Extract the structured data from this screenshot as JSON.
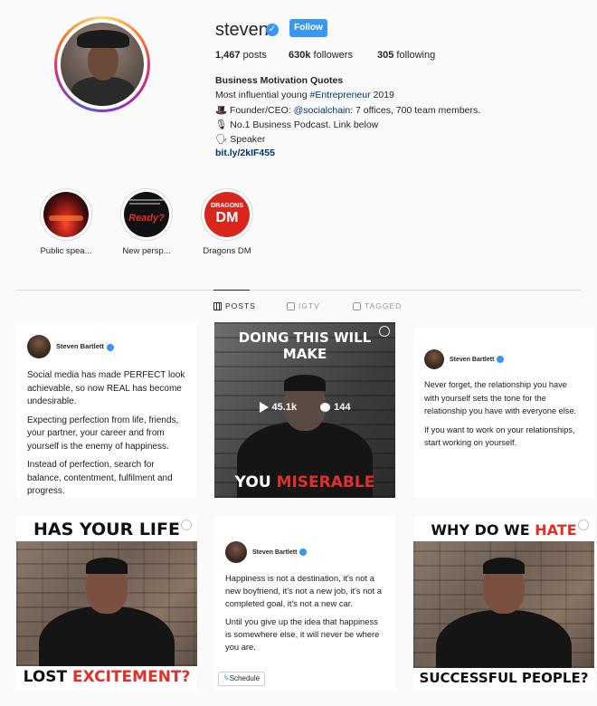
{
  "profile": {
    "username": "steven",
    "follow_label": "Follow",
    "stats": {
      "posts_count": "1,467",
      "posts_label": "posts",
      "followers_count": "630k",
      "followers_label": "followers",
      "following_count": "305",
      "following_label": "following"
    },
    "bio": {
      "name": "Business Motivation Quotes",
      "line1_prefix": "Most influential young ",
      "line1_tag": "#Entrepreneur",
      "line1_suffix": " 2019",
      "line2_prefix": "🎩 Founder/CEO: ",
      "line2_handle": "@socialchain",
      "line2_suffix": ": 7 offices, 700 team members.",
      "line3": "🎙 No.1 Business Podcast. Link below",
      "line4": "🗣 Speaker",
      "link": "bit.ly/2kIF455"
    }
  },
  "highlights": [
    {
      "label": "Public spea..."
    },
    {
      "label": "New persp...",
      "image_text": "Ready?"
    },
    {
      "label": "Dragons DM",
      "image_text_top": "DRAGONS",
      "image_text_bottom": "DM"
    }
  ],
  "tabs": [
    {
      "label": "POSTS",
      "icon": "grid-icon",
      "active": true
    },
    {
      "label": "IGTV",
      "icon": "igtv-icon",
      "active": false
    },
    {
      "label": "TAGGED",
      "icon": "tagged-icon",
      "active": false
    }
  ],
  "posts": [
    {
      "type": "text",
      "author": "Steven Bartlett",
      "paragraphs": [
        "Social media has made PERFECT look achievable, so now REAL has become undesirable.",
        "Expecting perfection from life, friends, your partner, your career and from yourself is the enemy of happiness.",
        "Instead of perfection, search for balance, contentment, fulfilment and progress."
      ]
    },
    {
      "type": "video",
      "caption_top": "DOING THIS WILL MAKE",
      "caption_bottom_white": "YOU ",
      "caption_bottom_red": "MISERABLE",
      "views": "45.1k",
      "comments": "144"
    },
    {
      "type": "text",
      "author": "Steven Bartlett",
      "paragraphs": [
        "Never forget, the relationship you have with yourself sets the tone for the relationship you have with everyone else.",
        "If you want to work on your relationships, start working on yourself."
      ]
    },
    {
      "type": "image",
      "caption_top": "HAS YOUR LIFE",
      "caption_bottom_black": "LOST ",
      "caption_bottom_red": "EXCITEMENT?"
    },
    {
      "type": "text",
      "author": "Steven Bartlett",
      "paragraphs": [
        "Happiness is not a destination, it's not a new boyfriend, it's not a new job, it's not a completed goal, it's not a new car.",
        "Until you give up the idea that happiness is somewhere else, it will never be where you are."
      ],
      "schedule_label": "Schedule"
    },
    {
      "type": "image",
      "caption_top_black": "WHY DO WE ",
      "caption_top_red": "HATE",
      "caption_bottom": "SUCCESSFUL PEOPLE?"
    }
  ],
  "colors": {
    "accent_blue": "#3897f0",
    "link_blue": "#003569",
    "caption_red": "#e0302a"
  }
}
